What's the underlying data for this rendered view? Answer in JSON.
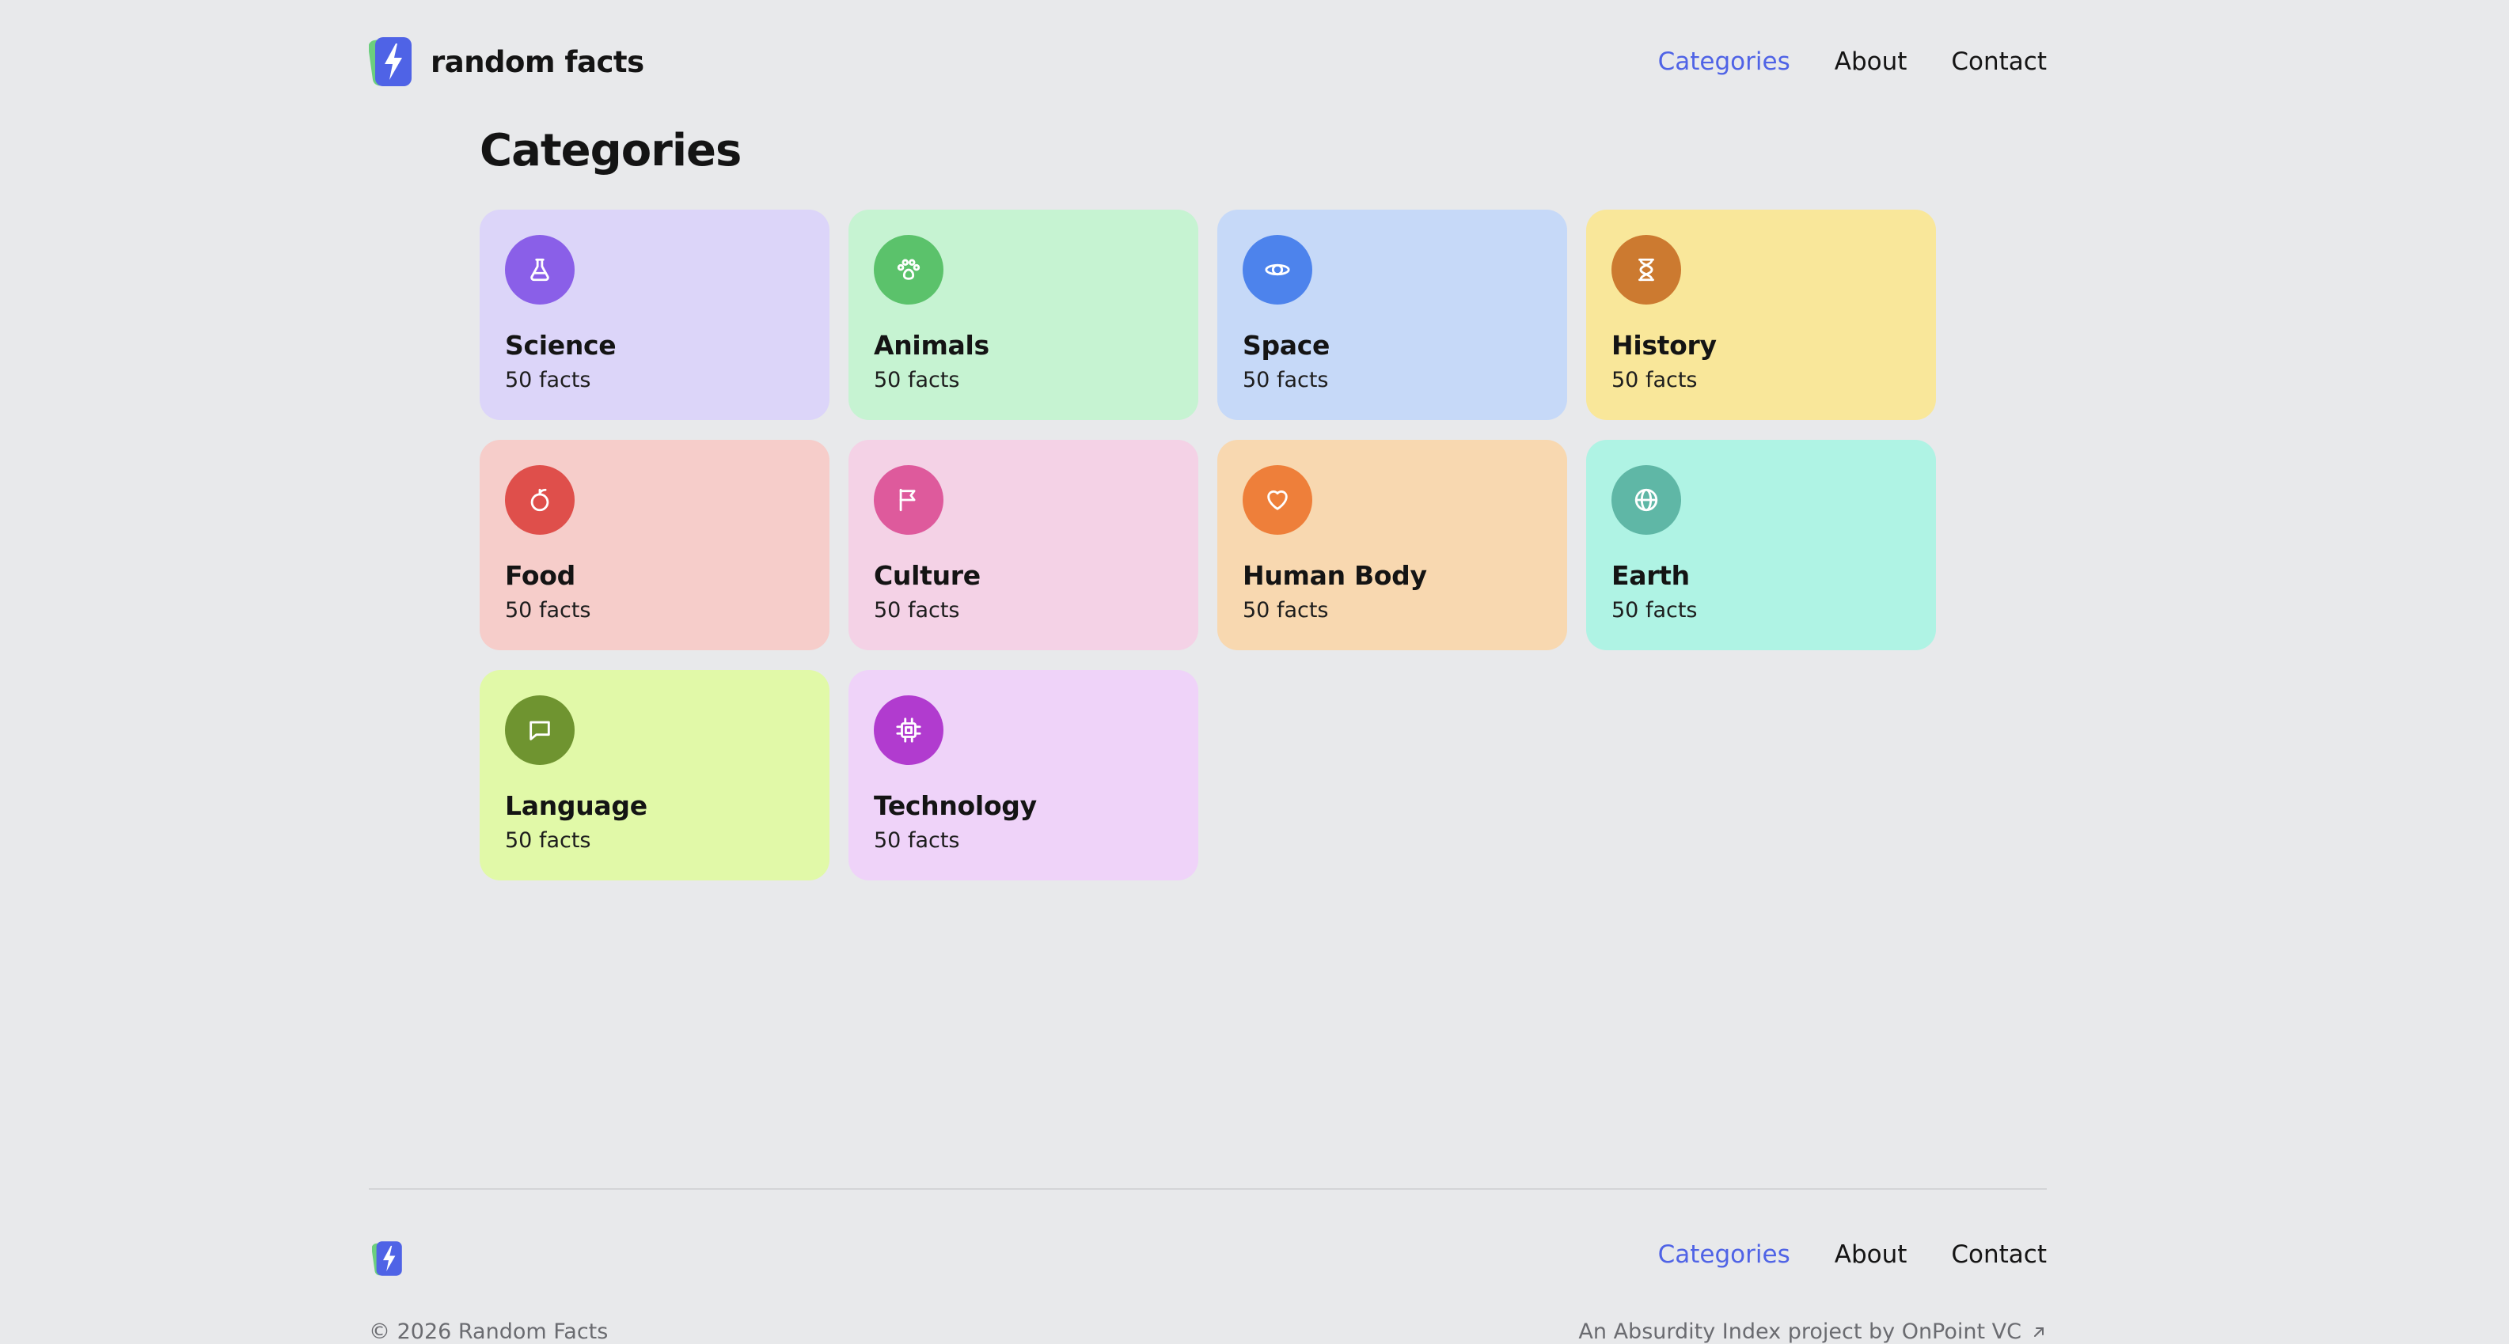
{
  "header": {
    "brand_name": "random facts",
    "nav": [
      {
        "label": "Categories",
        "active": true
      },
      {
        "label": "About",
        "active": false
      },
      {
        "label": "Contact",
        "active": false
      }
    ]
  },
  "main": {
    "title": "Categories",
    "categories": [
      {
        "name": "Science",
        "count": "50 facts",
        "icon": "flask-icon",
        "bg": "#dcd5f9",
        "accent": "#8a5fe8"
      },
      {
        "name": "Animals",
        "count": "50 facts",
        "icon": "paw-icon",
        "bg": "#c6f3d2",
        "accent": "#5bc26b"
      },
      {
        "name": "Space",
        "count": "50 facts",
        "icon": "planet-icon",
        "bg": "#c6d9f8",
        "accent": "#4d83ec"
      },
      {
        "name": "History",
        "count": "50 facts",
        "icon": "hourglass-icon",
        "bg": "#f9e79a",
        "accent": "#cc7a30"
      },
      {
        "name": "Food",
        "count": "50 facts",
        "icon": "apple-icon",
        "bg": "#f6cdca",
        "accent": "#df4f4b"
      },
      {
        "name": "Culture",
        "count": "50 facts",
        "icon": "flag-icon",
        "bg": "#f4d2e6",
        "accent": "#de5a9c"
      },
      {
        "name": "Human Body",
        "count": "50 facts",
        "icon": "heart-icon",
        "bg": "#f8d8b0",
        "accent": "#ee7f3a"
      },
      {
        "name": "Earth",
        "count": "50 facts",
        "icon": "globe-icon",
        "bg": "#aff3e4",
        "accent": "#5fb7a6"
      },
      {
        "name": "Language",
        "count": "50 facts",
        "icon": "speech-bubble-icon",
        "bg": "#e1f9a8",
        "accent": "#6f9430"
      },
      {
        "name": "Technology",
        "count": "50 facts",
        "icon": "chip-icon",
        "bg": "#efd3f9",
        "accent": "#b13bcf"
      }
    ]
  },
  "footer": {
    "nav": [
      {
        "label": "Categories",
        "active": true
      },
      {
        "label": "About",
        "active": false
      },
      {
        "label": "Contact",
        "active": false
      }
    ],
    "copyright": "© 2026 Random Facts",
    "credit": "An Absurdity Index project by OnPoint VC"
  },
  "colors": {
    "background": "#e8e9eb",
    "nav_active": "#4f63e6",
    "logo_blue": "#4f63e6",
    "logo_green": "#6ccf7e"
  }
}
